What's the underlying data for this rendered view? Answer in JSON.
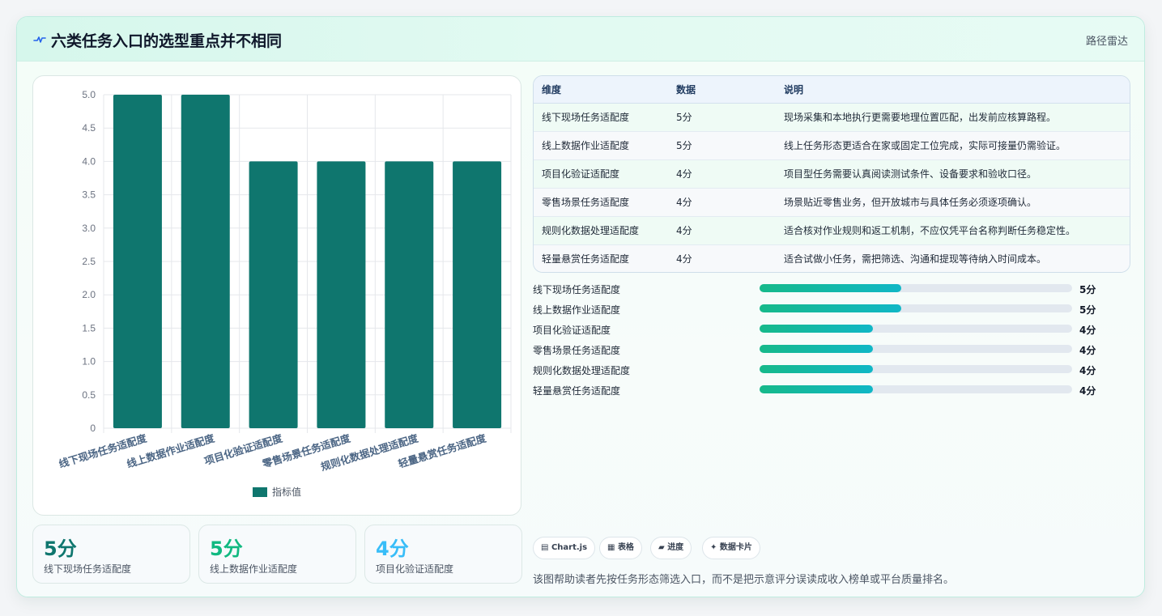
{
  "header": {
    "title": "六类任务入口的选型重点并不相同",
    "tag": "路径雷达"
  },
  "colors": {
    "bar": "#0f766e",
    "stat_1": "#0f766e",
    "stat_2": "#10b981",
    "stat_3": "#38bdf8"
  },
  "chart_data": {
    "type": "bar",
    "categories": [
      "线下现场任务适配度",
      "线上数据作业适配度",
      "项目化验证适配度",
      "零售场景任务适配度",
      "规则化数据处理适配度",
      "轻量悬赏任务适配度"
    ],
    "series": [
      {
        "name": "指标值",
        "values": [
          5,
          5,
          4,
          4,
          4,
          4
        ]
      }
    ],
    "ylim": [
      0,
      5
    ],
    "yticks": [
      "0",
      "0.5",
      "1.0",
      "1.5",
      "2.0",
      "2.5",
      "3.0",
      "3.5",
      "4.0",
      "4.5",
      "5.0"
    ],
    "grid": true,
    "legend": "bottom"
  },
  "stats": [
    {
      "value": "5分",
      "label": "线下现场任务适配度"
    },
    {
      "value": "5分",
      "label": "线上数据作业适配度"
    },
    {
      "value": "4分",
      "label": "项目化验证适配度"
    }
  ],
  "table": {
    "headers": [
      "维度",
      "数据",
      "说明"
    ],
    "rows": [
      [
        "线下现场任务适配度",
        "5分",
        "现场采集和本地执行更需要地理位置匹配，出发前应核算路程。"
      ],
      [
        "线上数据作业适配度",
        "5分",
        "线上任务形态更适合在家或固定工位完成，实际可接量仍需验证。"
      ],
      [
        "项目化验证适配度",
        "4分",
        "项目型任务需要认真阅读测试条件、设备要求和验收口径。"
      ],
      [
        "零售场景任务适配度",
        "4分",
        "场景贴近零售业务，但开放城市与具体任务必须逐项确认。"
      ],
      [
        "规则化数据处理适配度",
        "4分",
        "适合核对作业规则和返工机制，不应仅凭平台名称判断任务稳定性。"
      ],
      [
        "轻量悬赏任务适配度",
        "4分",
        "适合试做小任务，需把筛选、沟通和提现等待纳入时间成本。"
      ]
    ]
  },
  "progress": [
    {
      "label": "线下现场任务适配度",
      "value": "5分",
      "fraction": 0.453
    },
    {
      "label": "线上数据作业适配度",
      "value": "5分",
      "fraction": 0.453
    },
    {
      "label": "项目化验证适配度",
      "value": "4分",
      "fraction": 0.362
    },
    {
      "label": "零售场景任务适配度",
      "value": "4分",
      "fraction": 0.362
    },
    {
      "label": "规则化数据处理适配度",
      "value": "4分",
      "fraction": 0.362
    },
    {
      "label": "轻量悬赏任务适配度",
      "value": "4分",
      "fraction": 0.362
    }
  ],
  "chips": [
    {
      "icon": "chart-icon",
      "label": "Chart.js"
    },
    {
      "icon": "table-icon",
      "label": "表格"
    },
    {
      "icon": "progress-icon",
      "label": "进度"
    },
    {
      "icon": "sparkle-icon",
      "label": "数据卡片"
    }
  ],
  "footnote": "该图帮助读者先按任务形态筛选入口，而不是把示意评分误读成收入榜单或平台质量排名。"
}
